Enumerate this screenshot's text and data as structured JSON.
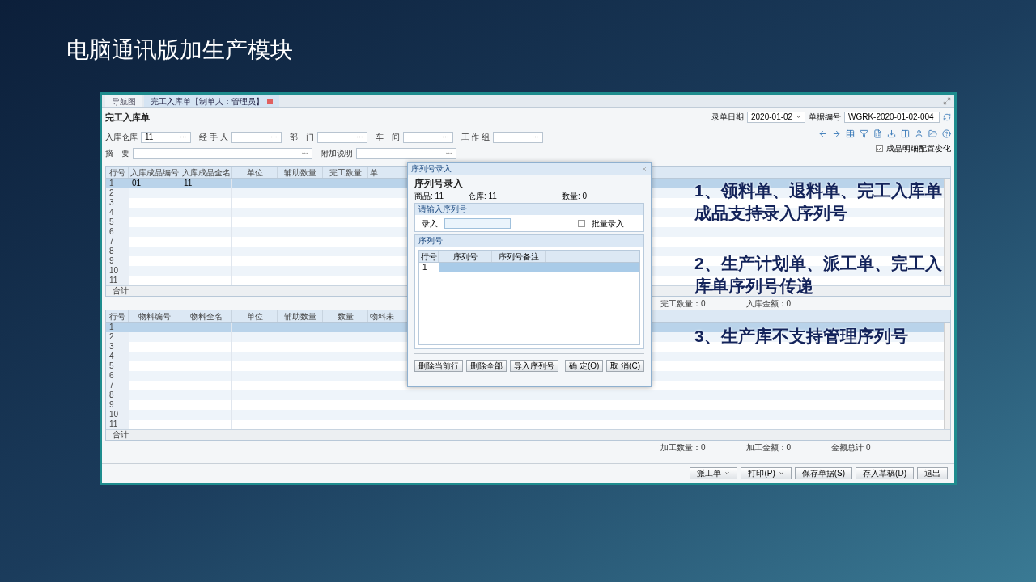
{
  "slide": {
    "title": "电脑通讯版加生产模块"
  },
  "tabs": [
    {
      "label": "导航图",
      "selected": false,
      "closable": false
    },
    {
      "label": "完工入库单【制单人：管理员】",
      "selected": true,
      "closable": true
    }
  ],
  "form_title": "完工入库单",
  "header_right": {
    "date_label": "录单日期",
    "date": "2020-01-02",
    "number_label": "单据编号",
    "number": "WGRK-2020-01-02-004"
  },
  "fields_row1": [
    {
      "label": "入库仓库",
      "value": "11"
    },
    {
      "label": "经 手 人"
    },
    {
      "label": "部　门"
    },
    {
      "label": "车　间"
    },
    {
      "label": "工 作 组"
    }
  ],
  "fields_row2": [
    {
      "label": "摘　要"
    },
    {
      "label": "附加说明"
    }
  ],
  "option": {
    "label": "成品明细配置变化",
    "checked": true
  },
  "product_table": {
    "columns": [
      "行号",
      "入库成品编号",
      "入库成品全名",
      "单位",
      "辅助数量",
      "完工数量",
      "单"
    ],
    "rows": [
      {
        "row": "1",
        "code": "01",
        "name": "11",
        "selected": true
      },
      {
        "row": "2",
        "selected": false
      },
      {
        "row": "3",
        "selected": false
      },
      {
        "row": "4",
        "selected": false
      },
      {
        "row": "5",
        "selected": false
      },
      {
        "row": "6",
        "selected": false
      },
      {
        "row": "7",
        "selected": false
      },
      {
        "row": "8",
        "selected": false
      },
      {
        "row": "9",
        "selected": false
      },
      {
        "row": "10",
        "selected": false
      },
      {
        "row": "11",
        "selected": false
      }
    ],
    "footer": "合计",
    "summary": [
      "完工数量：0",
      "入库金额：0"
    ]
  },
  "material_table": {
    "columns": [
      "行号",
      "物料编号",
      "物料全名",
      "单位",
      "辅助数量",
      "数量",
      "物料未"
    ],
    "rows": [
      {
        "row": "1",
        "selected": true
      },
      {
        "row": "2",
        "selected": false
      },
      {
        "row": "3",
        "selected": false
      },
      {
        "row": "4",
        "selected": false
      },
      {
        "row": "5",
        "selected": false
      },
      {
        "row": "6",
        "selected": false
      },
      {
        "row": "7",
        "selected": false
      },
      {
        "row": "8",
        "selected": false
      },
      {
        "row": "9",
        "selected": false
      },
      {
        "row": "10",
        "selected": false
      },
      {
        "row": "11",
        "selected": false
      }
    ],
    "footer": "合计",
    "summary": [
      "加工数量：0",
      "加工金额：0",
      "金额总计 0"
    ]
  },
  "buttons": [
    {
      "label": "派工单",
      "dropdown": true
    },
    {
      "label": "打印(P)",
      "dropdown": true
    },
    {
      "label": "保存单据(S)",
      "dropdown": false
    },
    {
      "label": "存入草稿(D)",
      "dropdown": false
    },
    {
      "label": "退出",
      "dropdown": false
    }
  ],
  "dialog": {
    "title": "序列号录入",
    "heading": "序列号录入",
    "info": [
      "商品: 11",
      "仓库: 11",
      "数量: 0"
    ],
    "input_section": "请输入序列号",
    "input_label": "录入",
    "batch": {
      "label": "批量录入",
      "checked": false
    },
    "list_section": "序列号",
    "columns": [
      "行号",
      "序列号",
      "序列号备注"
    ],
    "rows": [
      {
        "row": "1",
        "selected": true
      }
    ],
    "left_buttons": [
      "删除当前行",
      "删除全部",
      "导入序列号"
    ],
    "right_buttons": [
      "确 定(O)",
      "取 消(C)"
    ]
  },
  "notes": [
    "1、领料单、退料单、完工入库单成品支持录入序列号",
    "2、生产计划单、派工单、完工入库单序列号传递",
    "3、生产库不支持管理序列号"
  ]
}
